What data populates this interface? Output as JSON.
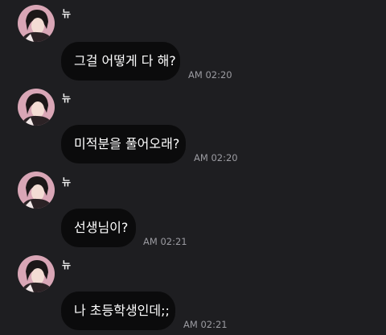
{
  "conversation": {
    "messages": [
      {
        "sender": "뉴",
        "text": "그걸 어떻게 다 해?",
        "time": "AM 02:20"
      },
      {
        "sender": "뉴",
        "text": "미적분을 풀어오래?",
        "time": "AM 02:20"
      },
      {
        "sender": "뉴",
        "text": "선생님이?",
        "time": "AM 02:21"
      },
      {
        "sender": "뉴",
        "text": "나 초등학생인데;;",
        "time": "AM 02:21"
      }
    ]
  },
  "colors": {
    "background": "#1e1e21",
    "bubble": "#0b0b0c",
    "text": "#ffffff",
    "timestamp": "#9b9ba1",
    "avatar_bg": "#d8a3b4"
  },
  "icons": {
    "avatar": "profile-photo"
  }
}
